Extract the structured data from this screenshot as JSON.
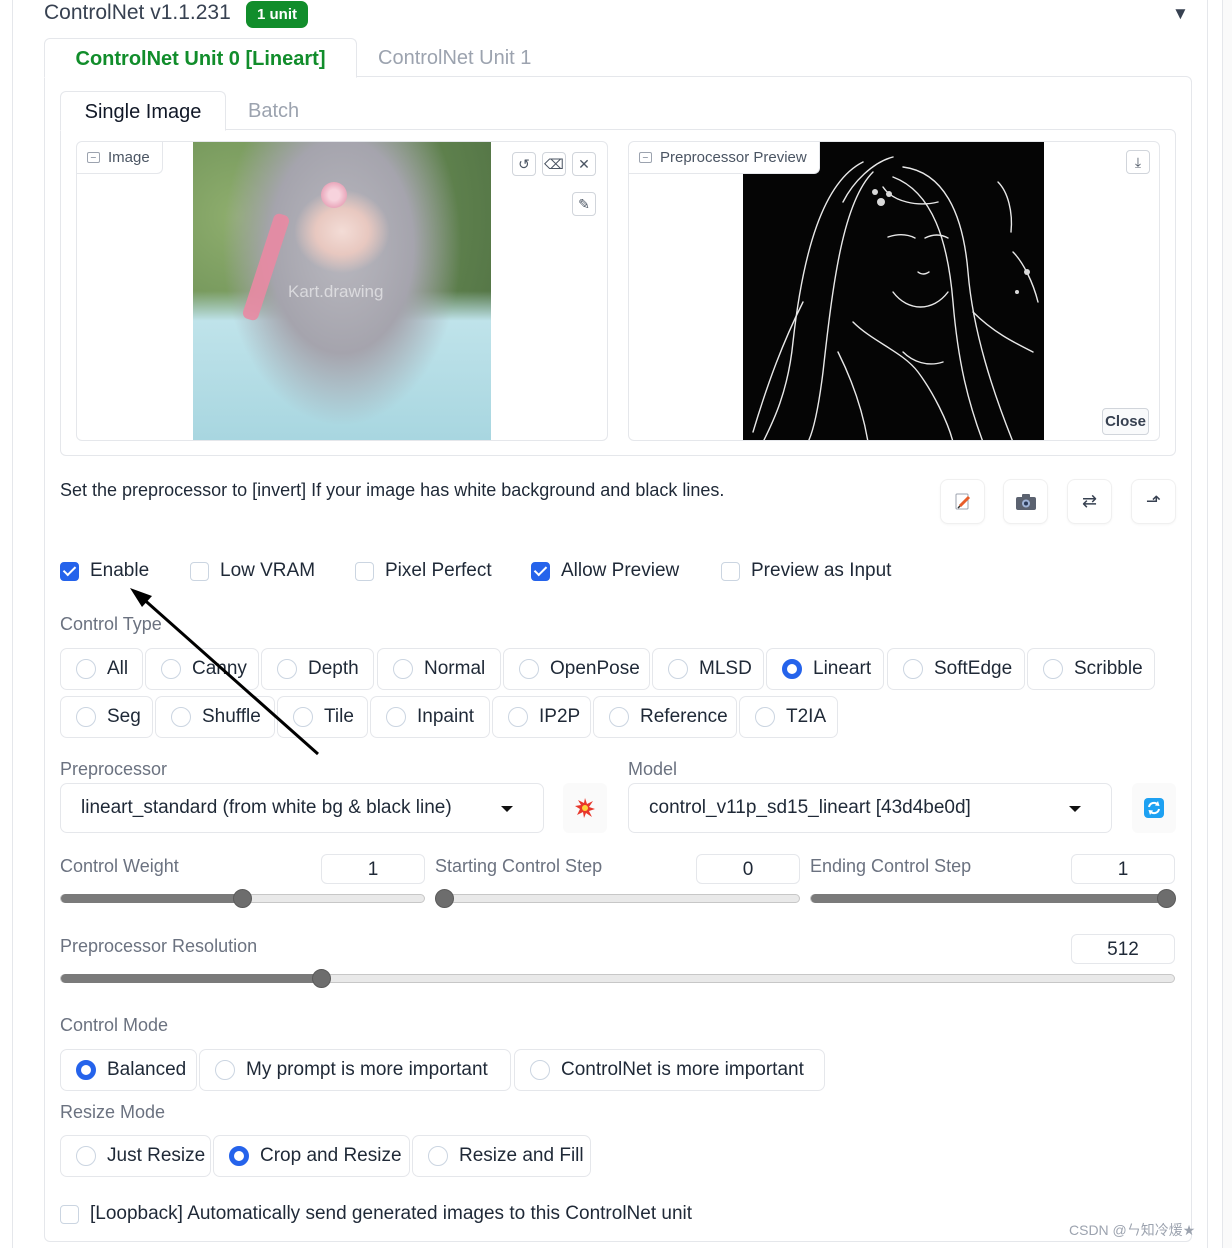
{
  "header": {
    "title": "ControlNet v1.1.231",
    "badge": "1 unit",
    "collapse_icon": "triangle-down-icon"
  },
  "unit_tabs": [
    {
      "label": "ControlNet Unit 0 [Lineart]",
      "active": true
    },
    {
      "label": "ControlNet Unit 1",
      "active": false
    }
  ],
  "image_tabs": [
    {
      "label": "Single Image",
      "active": true
    },
    {
      "label": "Batch",
      "active": false
    }
  ],
  "image_panel": {
    "label": "Image",
    "watermark": "Kart.drawing",
    "tools": [
      "undo-icon",
      "eraser-icon",
      "close-icon",
      "brush-icon"
    ]
  },
  "preview_panel": {
    "label": "Preprocessor Preview",
    "download_icon": "download-icon",
    "close_label": "Close"
  },
  "hint": "Set the preprocessor to [invert] If your image has white background and black lines.",
  "tool_buttons": [
    "edit-note-icon",
    "camera-icon",
    "swap-icon",
    "send-up-icon"
  ],
  "checkboxes": [
    {
      "label": "Enable",
      "checked": true
    },
    {
      "label": "Low VRAM",
      "checked": false
    },
    {
      "label": "Pixel Perfect",
      "checked": false
    },
    {
      "label": "Allow Preview",
      "checked": true
    },
    {
      "label": "Preview as Input",
      "checked": false
    }
  ],
  "control_type": {
    "label": "Control Type",
    "options": [
      "All",
      "Canny",
      "Depth",
      "Normal",
      "OpenPose",
      "MLSD",
      "Lineart",
      "SoftEdge",
      "Scribble",
      "Seg",
      "Shuffle",
      "Tile",
      "Inpaint",
      "IP2P",
      "Reference",
      "T2IA"
    ],
    "selected": "Lineart"
  },
  "preprocessor": {
    "label": "Preprocessor",
    "value": "lineart_standard (from white bg & black line)",
    "run_icon": "explosion-icon"
  },
  "model": {
    "label": "Model",
    "value": "control_v11p_sd15_lineart [43d4be0d]",
    "refresh_icon": "refresh-icon"
  },
  "sliders": {
    "control_weight": {
      "label": "Control Weight",
      "value": "1",
      "fraction": 0.5
    },
    "starting_step": {
      "label": "Starting Control Step",
      "value": "0",
      "fraction": 0.0
    },
    "ending_step": {
      "label": "Ending Control Step",
      "value": "1",
      "fraction": 1.0
    },
    "resolution": {
      "label": "Preprocessor Resolution",
      "value": "512",
      "fraction": 0.23
    }
  },
  "control_mode": {
    "label": "Control Mode",
    "options": [
      "Balanced",
      "My prompt is more important",
      "ControlNet is more important"
    ],
    "selected": "Balanced"
  },
  "resize_mode": {
    "label": "Resize Mode",
    "options": [
      "Just Resize",
      "Crop and Resize",
      "Resize and Fill"
    ],
    "selected": "Crop and Resize"
  },
  "loopback": {
    "label": "[Loopback] Automatically send generated images to this ControlNet unit",
    "checked": false
  },
  "credit": "CSDN @ㄣ知冷煖★",
  "colors": {
    "accent": "#2563eb",
    "tab_green": "#118d2b",
    "badge_green": "#118d2b",
    "annotation_arrow": "#000000"
  }
}
